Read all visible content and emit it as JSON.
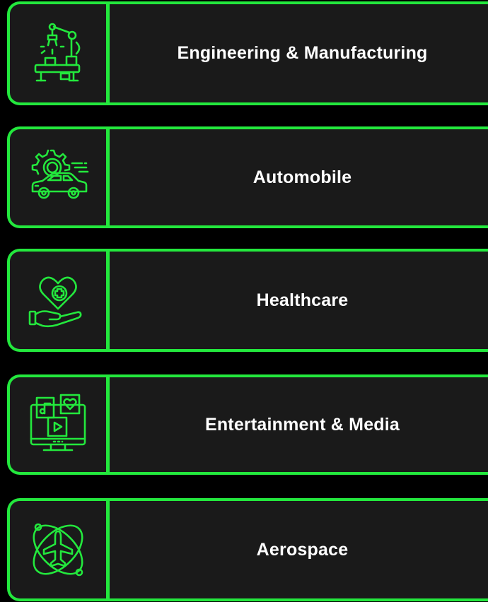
{
  "accent_color": "#23e83d",
  "background_color": "#1a1a1a",
  "industries": [
    {
      "label": "Engineering & Manufacturing",
      "icon": "robot-arm-icon"
    },
    {
      "label": "Automobile",
      "icon": "car-gear-icon"
    },
    {
      "label": "Healthcare",
      "icon": "heart-hand-icon"
    },
    {
      "label": "Entertainment & Media",
      "icon": "media-monitor-icon"
    },
    {
      "label": "Aerospace",
      "icon": "airplane-orbit-icon"
    }
  ]
}
